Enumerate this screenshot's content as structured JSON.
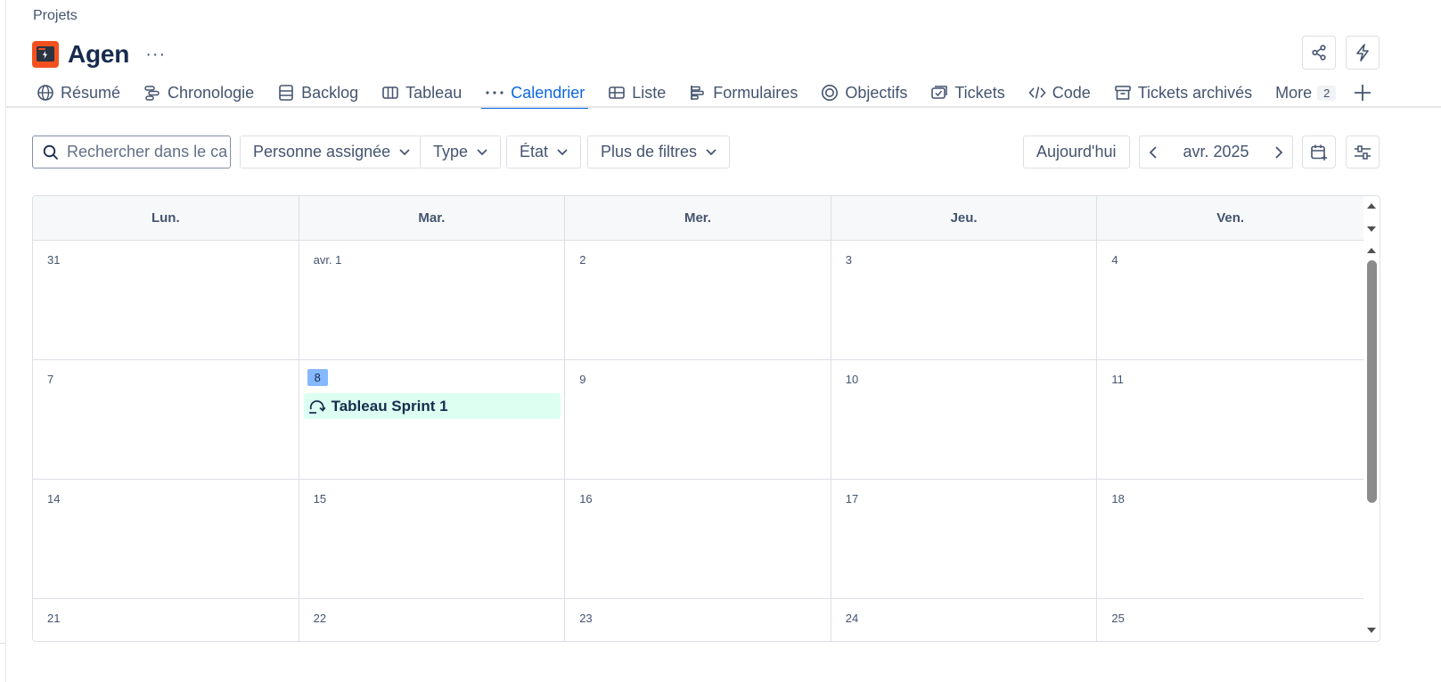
{
  "breadcrumb": "Projets",
  "project": {
    "title": "Agen",
    "more": "···",
    "icon": "project-rocket-icon",
    "icon_color": "#f4511e"
  },
  "header_actions": [
    {
      "icon": "share-icon"
    },
    {
      "icon": "lightning-icon"
    }
  ],
  "tabs": [
    {
      "label": "Résumé",
      "icon": "globe-icon"
    },
    {
      "label": "Chronologie",
      "icon": "timeline-icon"
    },
    {
      "label": "Backlog",
      "icon": "backlog-icon"
    },
    {
      "label": "Tableau",
      "icon": "board-icon"
    },
    {
      "label": "Calendrier",
      "icon": "dots-icon",
      "active": true
    },
    {
      "label": "Liste",
      "icon": "list-icon"
    },
    {
      "label": "Formulaires",
      "icon": "forms-icon"
    },
    {
      "label": "Objectifs",
      "icon": "target-icon"
    },
    {
      "label": "Tickets",
      "icon": "tickets-icon"
    },
    {
      "label": "Code",
      "icon": "code-icon"
    },
    {
      "label": "Tickets archivés",
      "icon": "archive-icon"
    },
    {
      "label": "More",
      "count": "2"
    }
  ],
  "add_tab": "+",
  "filters": {
    "search_placeholder": "Rechercher dans le ca...",
    "assignee": "Personne assignée",
    "type": "Type",
    "status": "État",
    "more_filters": "Plus de filtres"
  },
  "month_nav": {
    "today": "Aujourd'hui",
    "month": "avr. 2025"
  },
  "calendar": {
    "weekdays": [
      "Lun.",
      "Mar.",
      "Mer.",
      "Jeu.",
      "Ven."
    ],
    "weeks": [
      [
        "31",
        "avr. 1",
        "2",
        "3",
        "4"
      ],
      [
        "7",
        "8",
        "9",
        "10",
        "11"
      ],
      [
        "14",
        "15",
        "16",
        "17",
        "18"
      ],
      [
        "21",
        "22",
        "23",
        "24",
        "25"
      ]
    ],
    "event": {
      "label": "Tableau Sprint 1",
      "icon": "sprint-icon",
      "color": "#dcfff1"
    },
    "today_color": "#85b8ff"
  },
  "colors": {
    "accent": "#0c66e4",
    "text": "#172b4d",
    "subtle": "#44546f"
  }
}
